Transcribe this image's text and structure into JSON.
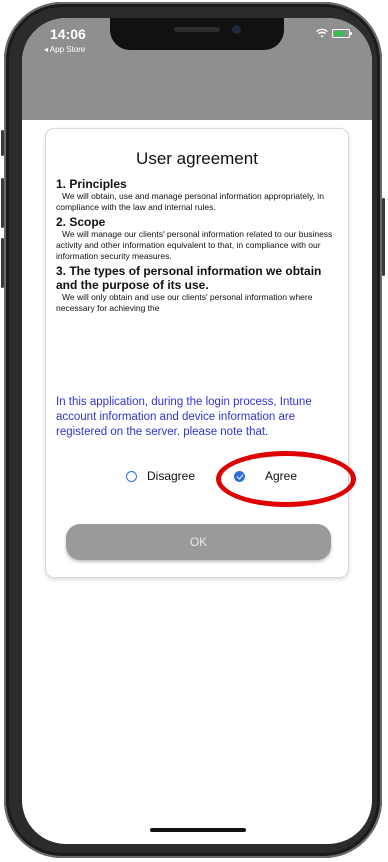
{
  "status_bar": {
    "time": "14:06",
    "back_label": "◂ App Store"
  },
  "dialog": {
    "title": "User agreement",
    "sections": [
      {
        "heading": "1. Principles",
        "body": "We will obtain, use and manage personal information appropriately, in compliance with the law and internal rules."
      },
      {
        "heading": "2. Scope",
        "body": "We will manage our clients' personal information related to our business activity and other information equivalent to that, in compliance with our information security measures."
      },
      {
        "heading": "3. The types of personal information we obtain and the purpose of its use.",
        "body": "We will only obtain and use our clients' personal information where necessary for achieving the"
      }
    ],
    "note": "In this application, during the login process, Intune account information and device information are registered on the server. please note that.",
    "options": {
      "disagree": "Disagree",
      "agree": "Agree",
      "selected": "agree"
    },
    "ok_label": "OK"
  },
  "colors": {
    "accent": "#2f6fdc",
    "note_text": "#3333cc",
    "highlight": "#e00000",
    "header_gray": "#8f8f8f"
  }
}
